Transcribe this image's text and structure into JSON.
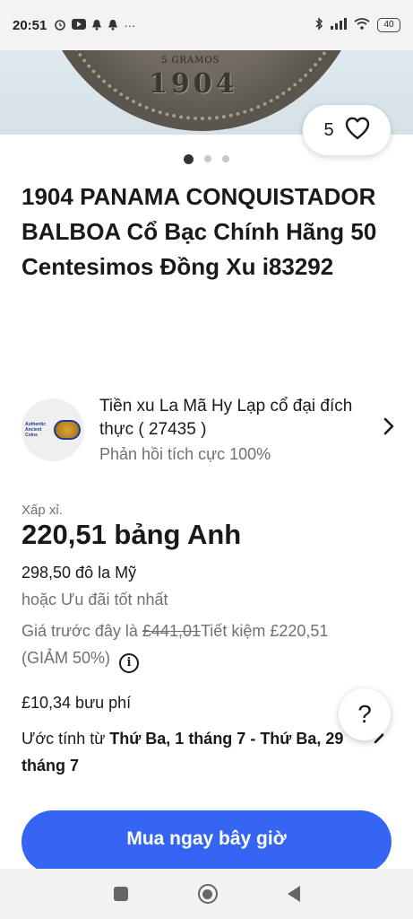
{
  "status_bar": {
    "time": "20:51",
    "icons_left": [
      "alarm-icon",
      "youtube-icon",
      "notification-bell-icon",
      "notification-bell-icon",
      "more-dots-icon"
    ],
    "icons_right": [
      "bluetooth-icon",
      "signal-icon",
      "wifi-icon",
      "battery-icon"
    ],
    "battery": "40",
    "more": "···"
  },
  "hero": {
    "coin_year": "1904",
    "coin_inscription": "5 GRAMOS"
  },
  "watch": {
    "count": "5",
    "icon": "heart-icon"
  },
  "gallery": {
    "dots_total": 3,
    "active_index": 0
  },
  "listing": {
    "title": "1904 PANAMA CONQUISTADOR BALBOA Cổ Bạc Chính Hãng 50 Centesimos Đồng Xu i83292"
  },
  "seller": {
    "name": "Tiền xu La Mã Hy Lạp cổ đại đích thực ( 27435 )",
    "feedback": "Phản hồi tích cực 100%",
    "logo_text_1": "Authentic",
    "logo_text_2": "Ancient",
    "logo_text_3": "Coins"
  },
  "price": {
    "approx_label": "Xấp xỉ.",
    "main": "220,51 bảng Anh",
    "usd": "298,50 đô la Mỹ",
    "best_offer": "hoặc Ưu đãi tốt nhất",
    "was_prefix": "Giá trước đây là ",
    "was_price": "£441,01",
    "savings": "Tiết kiệm £220,51",
    "discount": "(GIẢM 50%)",
    "info_glyph": "i"
  },
  "shipping": {
    "cost": "£10,34 bưu phí",
    "estimate_prefix": "Ước tính từ ",
    "estimate_dates": "Thứ Ba, 1 tháng 7 - Thứ Ba, 29 tháng 7"
  },
  "help": {
    "label": "?"
  },
  "actions": {
    "buy_now": "Mua ngay bây giờ"
  },
  "colors": {
    "accent": "#3665f3",
    "text": "#191919",
    "muted": "#707070"
  }
}
